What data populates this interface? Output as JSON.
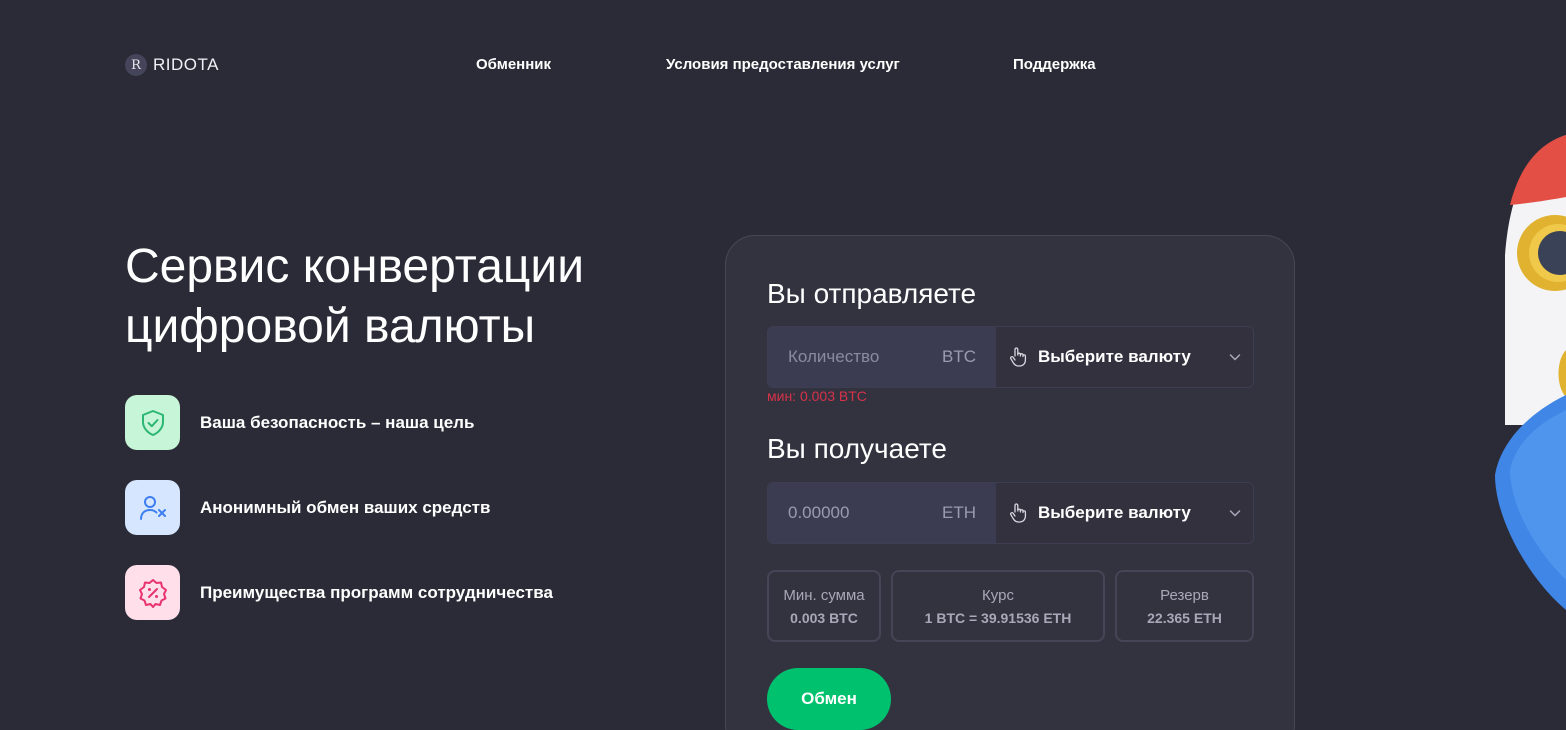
{
  "header": {
    "logo_letter": "R",
    "logo_text": "RIDOTA",
    "nav": [
      {
        "label": "Обменник"
      },
      {
        "label": "Условия предоставления услуг"
      },
      {
        "label": "Поддержка"
      }
    ]
  },
  "hero": {
    "title": "Сервис конвертации цифровой валюты",
    "features": [
      {
        "label": "Ваша безопасность – наша цель",
        "icon": "shield-check-icon",
        "color": "#c7f5d7"
      },
      {
        "label": "Анонимный обмен ваших средств",
        "icon": "user-x-icon",
        "color": "#d6e6ff"
      },
      {
        "label": "Преимущества программ сотрудничества",
        "icon": "discount-badge-icon",
        "color": "#ffe0ea"
      }
    ]
  },
  "exchange": {
    "send": {
      "title": "Вы отправляете",
      "amount_placeholder": "Количество",
      "ticker": "BTC",
      "select_label": "Выберите валюту",
      "min_note": "мин: 0.003 BTC"
    },
    "receive": {
      "title": "Вы получаете",
      "amount_value": "0.00000",
      "ticker": "ETH",
      "select_label": "Выберите валюту"
    },
    "stats": {
      "min": {
        "label": "Мин. сумма",
        "value": "0.003 BTC"
      },
      "rate": {
        "label": "Курс",
        "value": "1 BTC = 39.91536 ETH"
      },
      "reserve": {
        "label": "Резерв",
        "value": "22.365 ETH"
      }
    },
    "button_label": "Обмен",
    "colors": {
      "accent": "#00c26e",
      "error": "#d6324a"
    }
  }
}
